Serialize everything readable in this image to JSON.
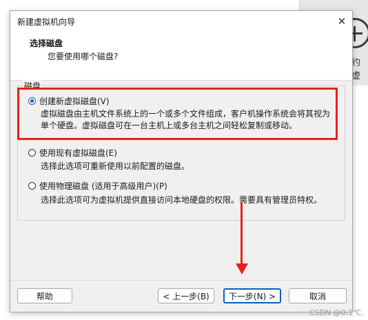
{
  "background": {
    "side_text": "约虚"
  },
  "dialog": {
    "title": "新建虚拟机向导",
    "close_glyph": "✕",
    "header": {
      "title": "选择磁盘",
      "subtitle": "您要使用哪个磁盘?"
    },
    "group_label": "磁盘",
    "options": [
      {
        "label": "创建新虚拟磁盘(V)",
        "checked": true,
        "desc_line1": "虚拟磁盘由主机文件系统上的一个或多个文件组成，客户机操作系统会将其视为",
        "desc_line2": "单个硬盘。虚拟磁盘可在一台主机上或多台主机之间轻松复制或移动。"
      },
      {
        "label": "使用现有虚拟磁盘(E)",
        "checked": false,
        "desc_line1": "选择此选项可重新使用以前配置的磁盘。"
      },
      {
        "label": "使用物理磁盘 (适用于高级用户)(P)",
        "checked": false,
        "desc_line1": "选择此选项可为虚拟机提供直接访问本地硬盘的权限。需要具有管理员特权。"
      }
    ],
    "buttons": {
      "help": "帮助",
      "back": "< 上一步(B)",
      "next": "下一步(N) >",
      "cancel": "取消"
    }
  },
  "watermark": "CSDN @0.1℃.",
  "colors": {
    "annotation_red": "#e8201b",
    "accent_blue": "#0a5dbf"
  }
}
